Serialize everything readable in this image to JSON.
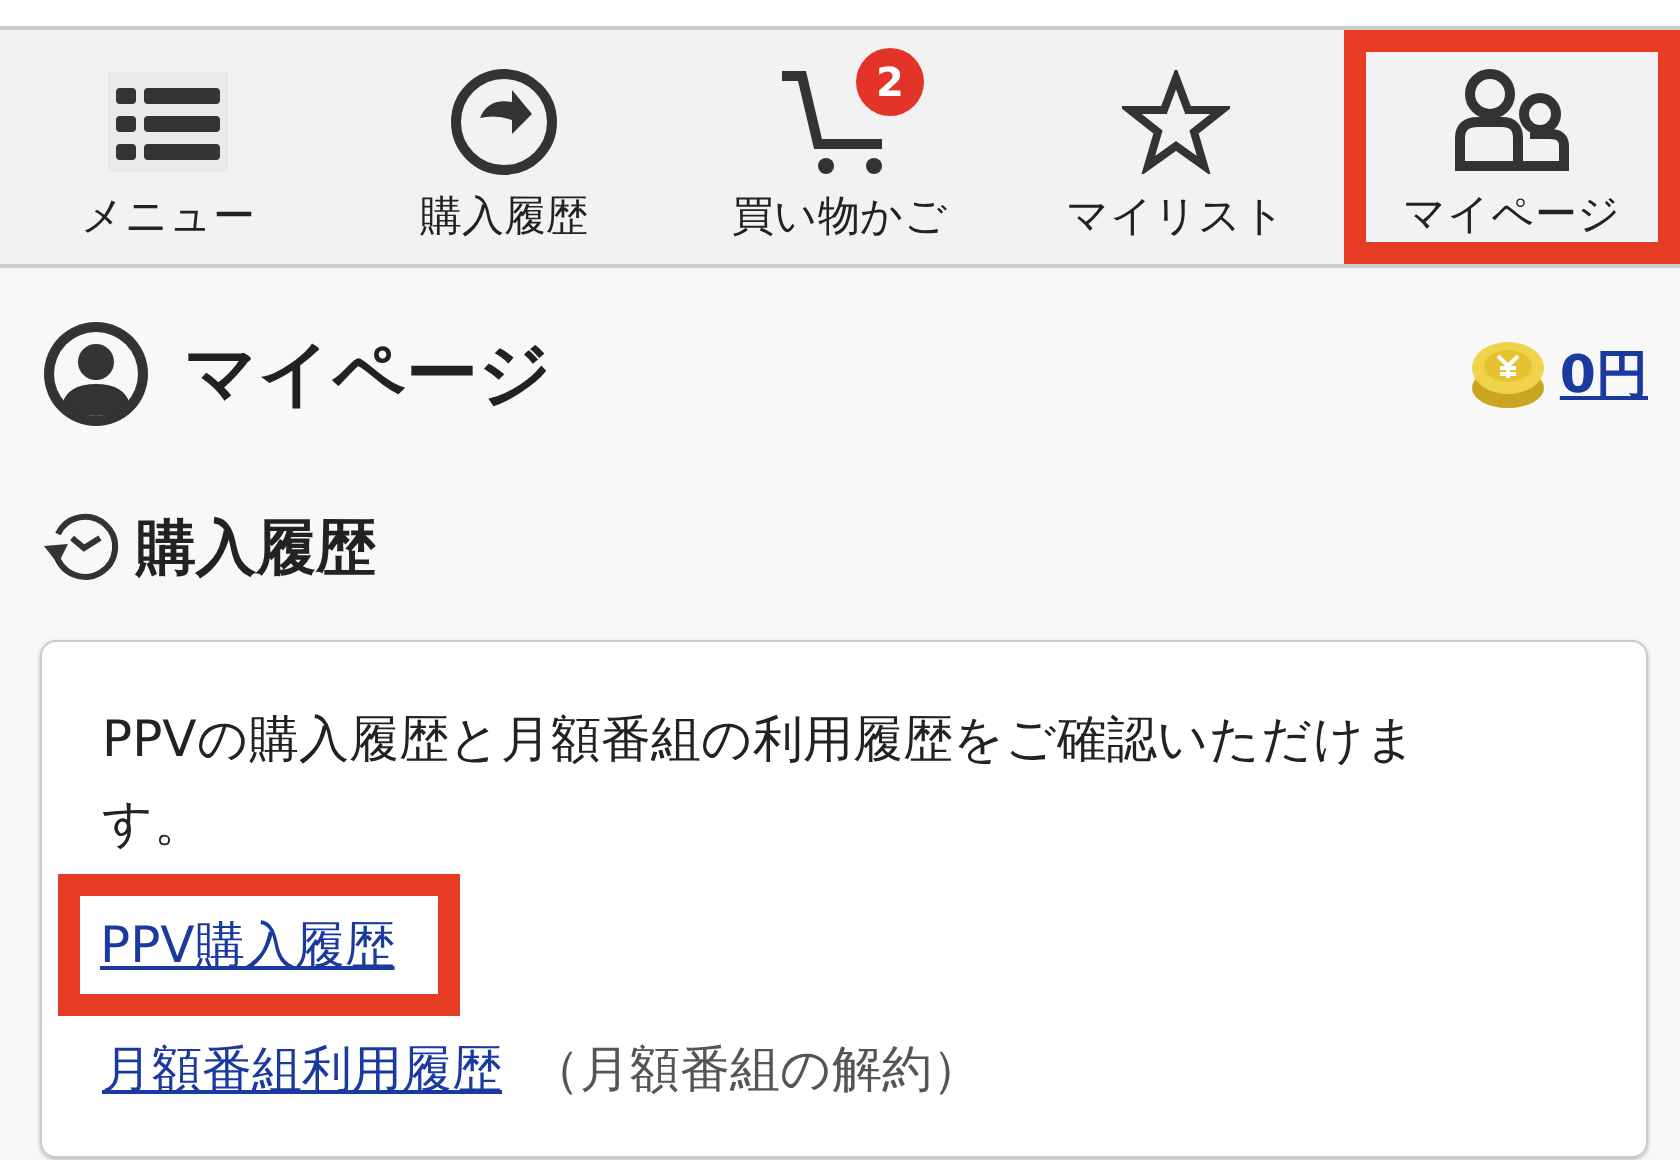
{
  "nav": [
    {
      "kind": "menu",
      "label": "メニュー",
      "highlighted": false
    },
    {
      "kind": "history",
      "label": "購入履歴",
      "highlighted": false
    },
    {
      "kind": "cart",
      "label": "買い物かご",
      "badge": "2",
      "highlighted": false
    },
    {
      "kind": "mylist",
      "label": "マイリスト",
      "highlighted": false
    },
    {
      "kind": "mypage",
      "label": "マイページ",
      "highlighted": true
    }
  ],
  "page": {
    "title": "マイページ",
    "balance": "0円"
  },
  "section": {
    "title": "購入履歴",
    "description": "PPVの購入履歴と月額番組の利用履歴をご確認いただけます。",
    "links": [
      {
        "label": "PPV購入履歴",
        "highlighted": true
      },
      {
        "label": "月額番組利用履歴",
        "note": "（月額番組の解約）",
        "highlighted": false
      }
    ]
  }
}
